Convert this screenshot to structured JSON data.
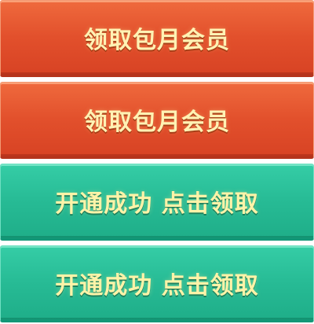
{
  "buttons": [
    {
      "label": "领取包月会员",
      "color": "#e2502c"
    },
    {
      "label": "领取包月会员",
      "color": "#e2502c"
    },
    {
      "label": "开通成功 点击领取",
      "color": "#27bb95"
    },
    {
      "label": "开通成功 点击领取",
      "color": "#27bb95"
    }
  ],
  "text_color": "#fff2b4"
}
